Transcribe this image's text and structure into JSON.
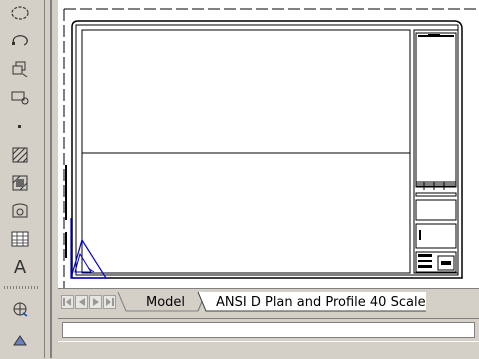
{
  "toolbar": {
    "tools": [
      {
        "name": "revcloud-icon"
      },
      {
        "name": "ellipse-arc-icon"
      },
      {
        "name": "insert-block-icon"
      },
      {
        "name": "make-block-icon"
      },
      {
        "name": "point-icon"
      },
      {
        "name": "hatch-icon"
      },
      {
        "name": "gradient-icon"
      },
      {
        "name": "region-icon"
      },
      {
        "name": "table-icon"
      },
      {
        "name": "multiline-text-icon",
        "label": "A"
      },
      {
        "name": "orbit-icon"
      },
      {
        "name": "layer-icon"
      }
    ]
  },
  "layout_tabs": {
    "model_label": "Model",
    "sheet_label": "ANSI D Plan and Profile 40 Scale"
  },
  "colors": {
    "ui_gray": "#d4d0c8",
    "canvas": "#ffffff",
    "ucs_icon": "#0000cc"
  }
}
